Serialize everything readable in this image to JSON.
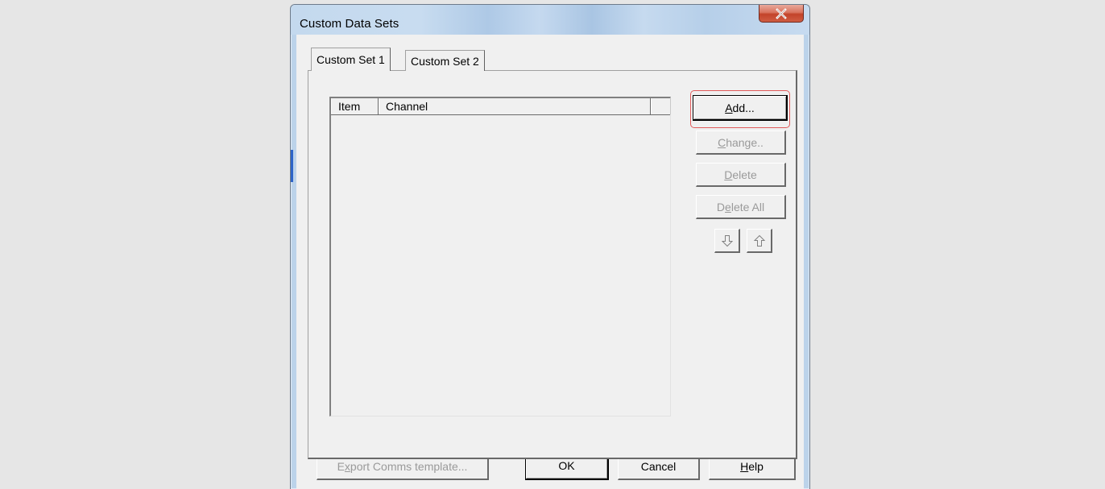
{
  "window": {
    "title": "Custom Data Sets",
    "close_icon": "close-x-icon"
  },
  "tabs": [
    {
      "label": "Custom Set 1",
      "selected": true
    },
    {
      "label": "Custom Set 2",
      "selected": false
    }
  ],
  "listview": {
    "columns": [
      "Item",
      "Channel",
      ""
    ],
    "rows": []
  },
  "side_buttons": {
    "add": {
      "pre": "",
      "key": "A",
      "post": "dd...",
      "enabled": true
    },
    "change": {
      "pre": "",
      "key": "C",
      "post": "hange..",
      "enabled": false
    },
    "delete": {
      "pre": "",
      "key": "D",
      "post": "elete",
      "enabled": false
    },
    "delete_all": {
      "pre": "D",
      "key": "e",
      "post": "lete All",
      "enabled": false
    },
    "move_down_icon": "arrow-down-icon",
    "move_up_icon": "arrow-up-icon"
  },
  "bottom_buttons": {
    "export": {
      "pre": "E",
      "key": "x",
      "post": "port Comms template...",
      "enabled": false
    },
    "ok": {
      "label": "OK"
    },
    "cancel": {
      "label": "Cancel"
    },
    "help": {
      "pre": "",
      "key": "H",
      "post": "elp"
    }
  },
  "highlight_color": "#e05a5a"
}
